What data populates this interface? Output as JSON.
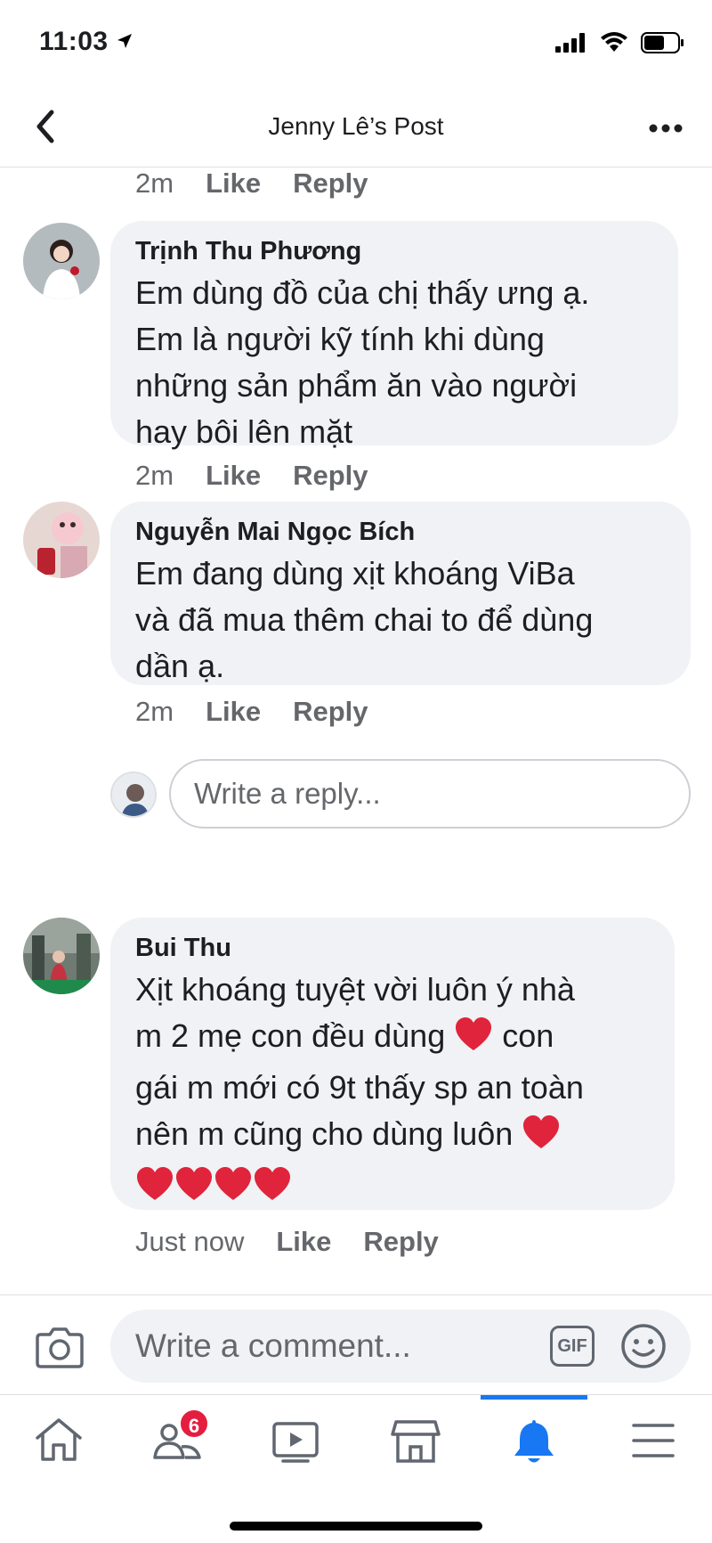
{
  "status_bar": {
    "time": "11:03",
    "battery_level": 0.6
  },
  "header": {
    "title": "Jenny Lê’s Post"
  },
  "top_meta": {
    "time": "2m",
    "like": "Like",
    "reply": "Reply"
  },
  "comments": [
    {
      "author": "Trịnh Thu Phương",
      "lines": [
        "Em dùng đồ của chị thấy ưng ạ.",
        "Em là người kỹ tính khi dùng",
        "những sản phẩm ăn vào người",
        "hay bôi lên mặt"
      ],
      "time": "2m",
      "like": "Like",
      "reply": "Reply"
    },
    {
      "author": "Nguyễn Mai Ngọc Bích",
      "lines": [
        "Em đang dùng xịt khoáng ViBa",
        "và đã mua thêm chai to để dùng",
        "dần ạ."
      ],
      "time": "2m",
      "like": "Like",
      "reply": "Reply"
    },
    {
      "author": "Bui Thu",
      "lines": [
        "Xịt khoáng tuyệt vời luôn ý nhà",
        "m 2 mẹ con đều dùng",
        "con",
        "gái m mới có 9t thấy sp an toàn",
        "nên m cũng cho dùng luôn"
      ],
      "time": "Just now",
      "like": "Like",
      "reply": "Reply"
    }
  ],
  "reply_box": {
    "placeholder": "Write a reply..."
  },
  "composer": {
    "placeholder": "Write a comment...",
    "gif_label": "GIF"
  },
  "tabbar": {
    "friends_badge": "6",
    "active_tab": "notifications"
  },
  "colors": {
    "accent": "#1877f2",
    "bubble": "#f0f2f5",
    "heart": "#e0243b",
    "badge": "#e41e3f"
  }
}
